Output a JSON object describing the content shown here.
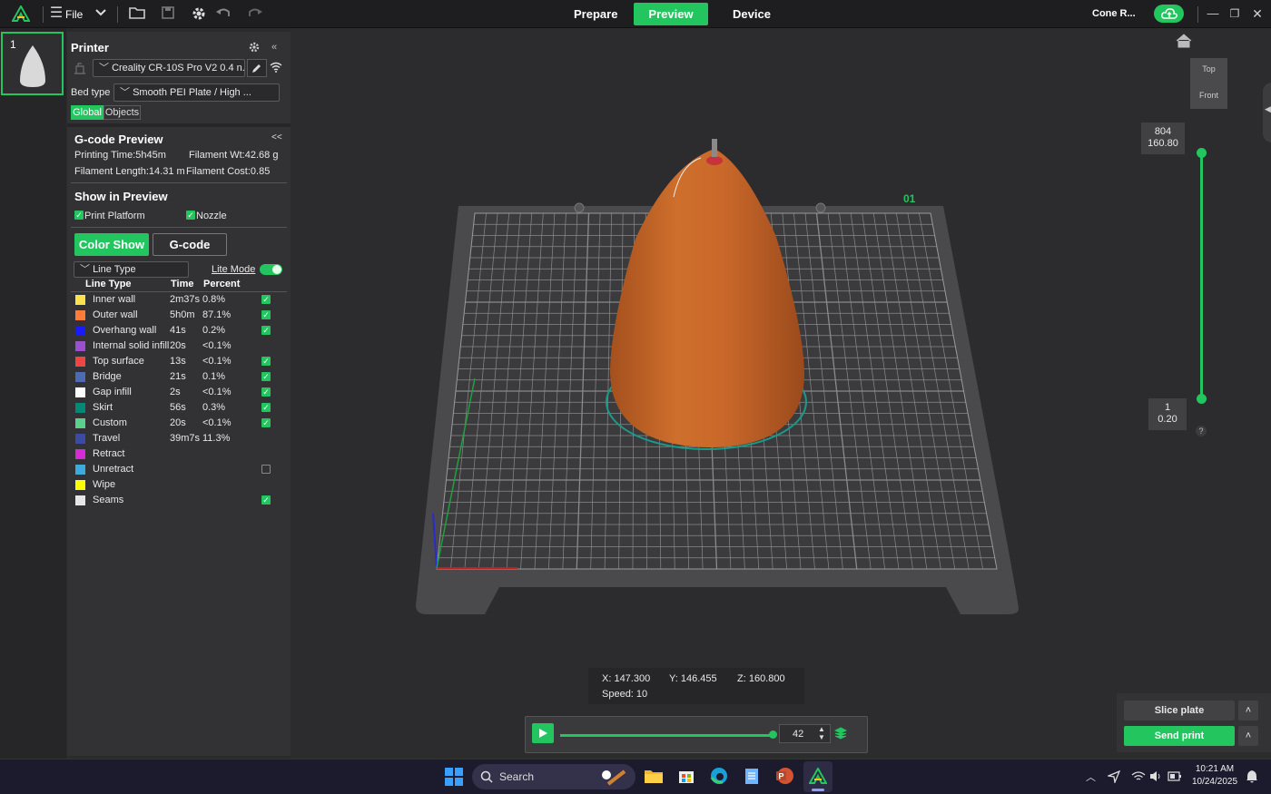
{
  "topbar": {
    "file_label": "File",
    "tabs": [
      {
        "label": "Prepare",
        "active": false
      },
      {
        "label": "Preview",
        "active": true
      },
      {
        "label": "Device",
        "active": false
      }
    ],
    "project_name": "Cone R..."
  },
  "plate_list": {
    "number": "1"
  },
  "printer": {
    "title": "Printer",
    "name": "Creality CR-10S Pro V2 0.4 n...",
    "bed_type_label": "Bed type",
    "bed_type_value": "Smooth PEI Plate / High ...",
    "tab_global": "Global",
    "tab_objects": "Objects"
  },
  "gcode_preview": {
    "title": "G-code Preview",
    "collapse": "<<",
    "printing_time": "Printing Time:5h45m",
    "filament_wt": "Filament Wt:42.68 g",
    "filament_length": "Filament Length:14.31 m",
    "filament_cost": "Filament Cost:0.85"
  },
  "show_in_preview": {
    "title": "Show in Preview",
    "print_platform": "Print Platform",
    "nozzle": "Nozzle"
  },
  "mode_buttons": {
    "color_show": "Color Show",
    "gcode": "G-code"
  },
  "legend": {
    "type_select": "Line Type",
    "lite_mode": "Lite Mode",
    "headers": {
      "line_type": "Line Type",
      "time": "Time",
      "percent": "Percent"
    },
    "rows": [
      {
        "name": "Inner wall",
        "time": "2m37s",
        "percent": "0.8%",
        "color": "#ffe04d",
        "checked": true
      },
      {
        "name": "Outer wall",
        "time": "5h0m",
        "percent": "87.1%",
        "color": "#ff7b39",
        "checked": true
      },
      {
        "name": "Overhang wall",
        "time": "41s",
        "percent": "0.2%",
        "color": "#1a1aff",
        "checked": true
      },
      {
        "name": "Internal solid infill",
        "time": "20s",
        "percent": "<0.1%",
        "color": "#9b4fd1",
        "checked": false
      },
      {
        "name": "Top surface",
        "time": "13s",
        "percent": "<0.1%",
        "color": "#f04545",
        "checked": true
      },
      {
        "name": "Bridge",
        "time": "21s",
        "percent": "0.1%",
        "color": "#4d6bb3",
        "checked": true
      },
      {
        "name": "Gap infill",
        "time": "2s",
        "percent": "<0.1%",
        "color": "#ffffff",
        "checked": true
      },
      {
        "name": "Skirt",
        "time": "56s",
        "percent": "0.3%",
        "color": "#008a75",
        "checked": true
      },
      {
        "name": "Custom",
        "time": "20s",
        "percent": "<0.1%",
        "color": "#5ccf8a",
        "checked": true
      },
      {
        "name": "Travel",
        "time": "39m7s",
        "percent": "11.3%",
        "color": "#3b4ba3",
        "checked": false
      },
      {
        "name": "Retract",
        "time": "",
        "percent": "",
        "color": "#d62ad6",
        "checked": false
      },
      {
        "name": "Unretract",
        "time": "",
        "percent": "",
        "color": "#3fa8dc",
        "checked": false,
        "empty_box": true
      },
      {
        "name": "Wipe",
        "time": "",
        "percent": "",
        "color": "#ffff00",
        "checked": false
      },
      {
        "name": "Seams",
        "time": "",
        "percent": "",
        "color": "#e6e6e6",
        "checked": true
      }
    ]
  },
  "view_cube": {
    "top": "Top",
    "front": "Front"
  },
  "plate_label": "01",
  "layer_slider": {
    "top_layer": "804",
    "top_height": "160.80",
    "bottom_layer": "1",
    "bottom_height": "0.20",
    "help": "?"
  },
  "position_readout": {
    "x": "X: 147.300",
    "y": "Y: 146.455",
    "z": "Z: 160.800",
    "speed": "Speed: 10"
  },
  "move_slider": {
    "value": "42",
    "progress": 1.0
  },
  "actions": {
    "slice_plate": "Slice plate",
    "send_print": "Send print"
  },
  "taskbar": {
    "search_placeholder": "Search",
    "time": "10:21 AM",
    "date": "10/24/2025"
  },
  "colors": {
    "accent": "#22c55e",
    "model": "#c96a2a"
  }
}
